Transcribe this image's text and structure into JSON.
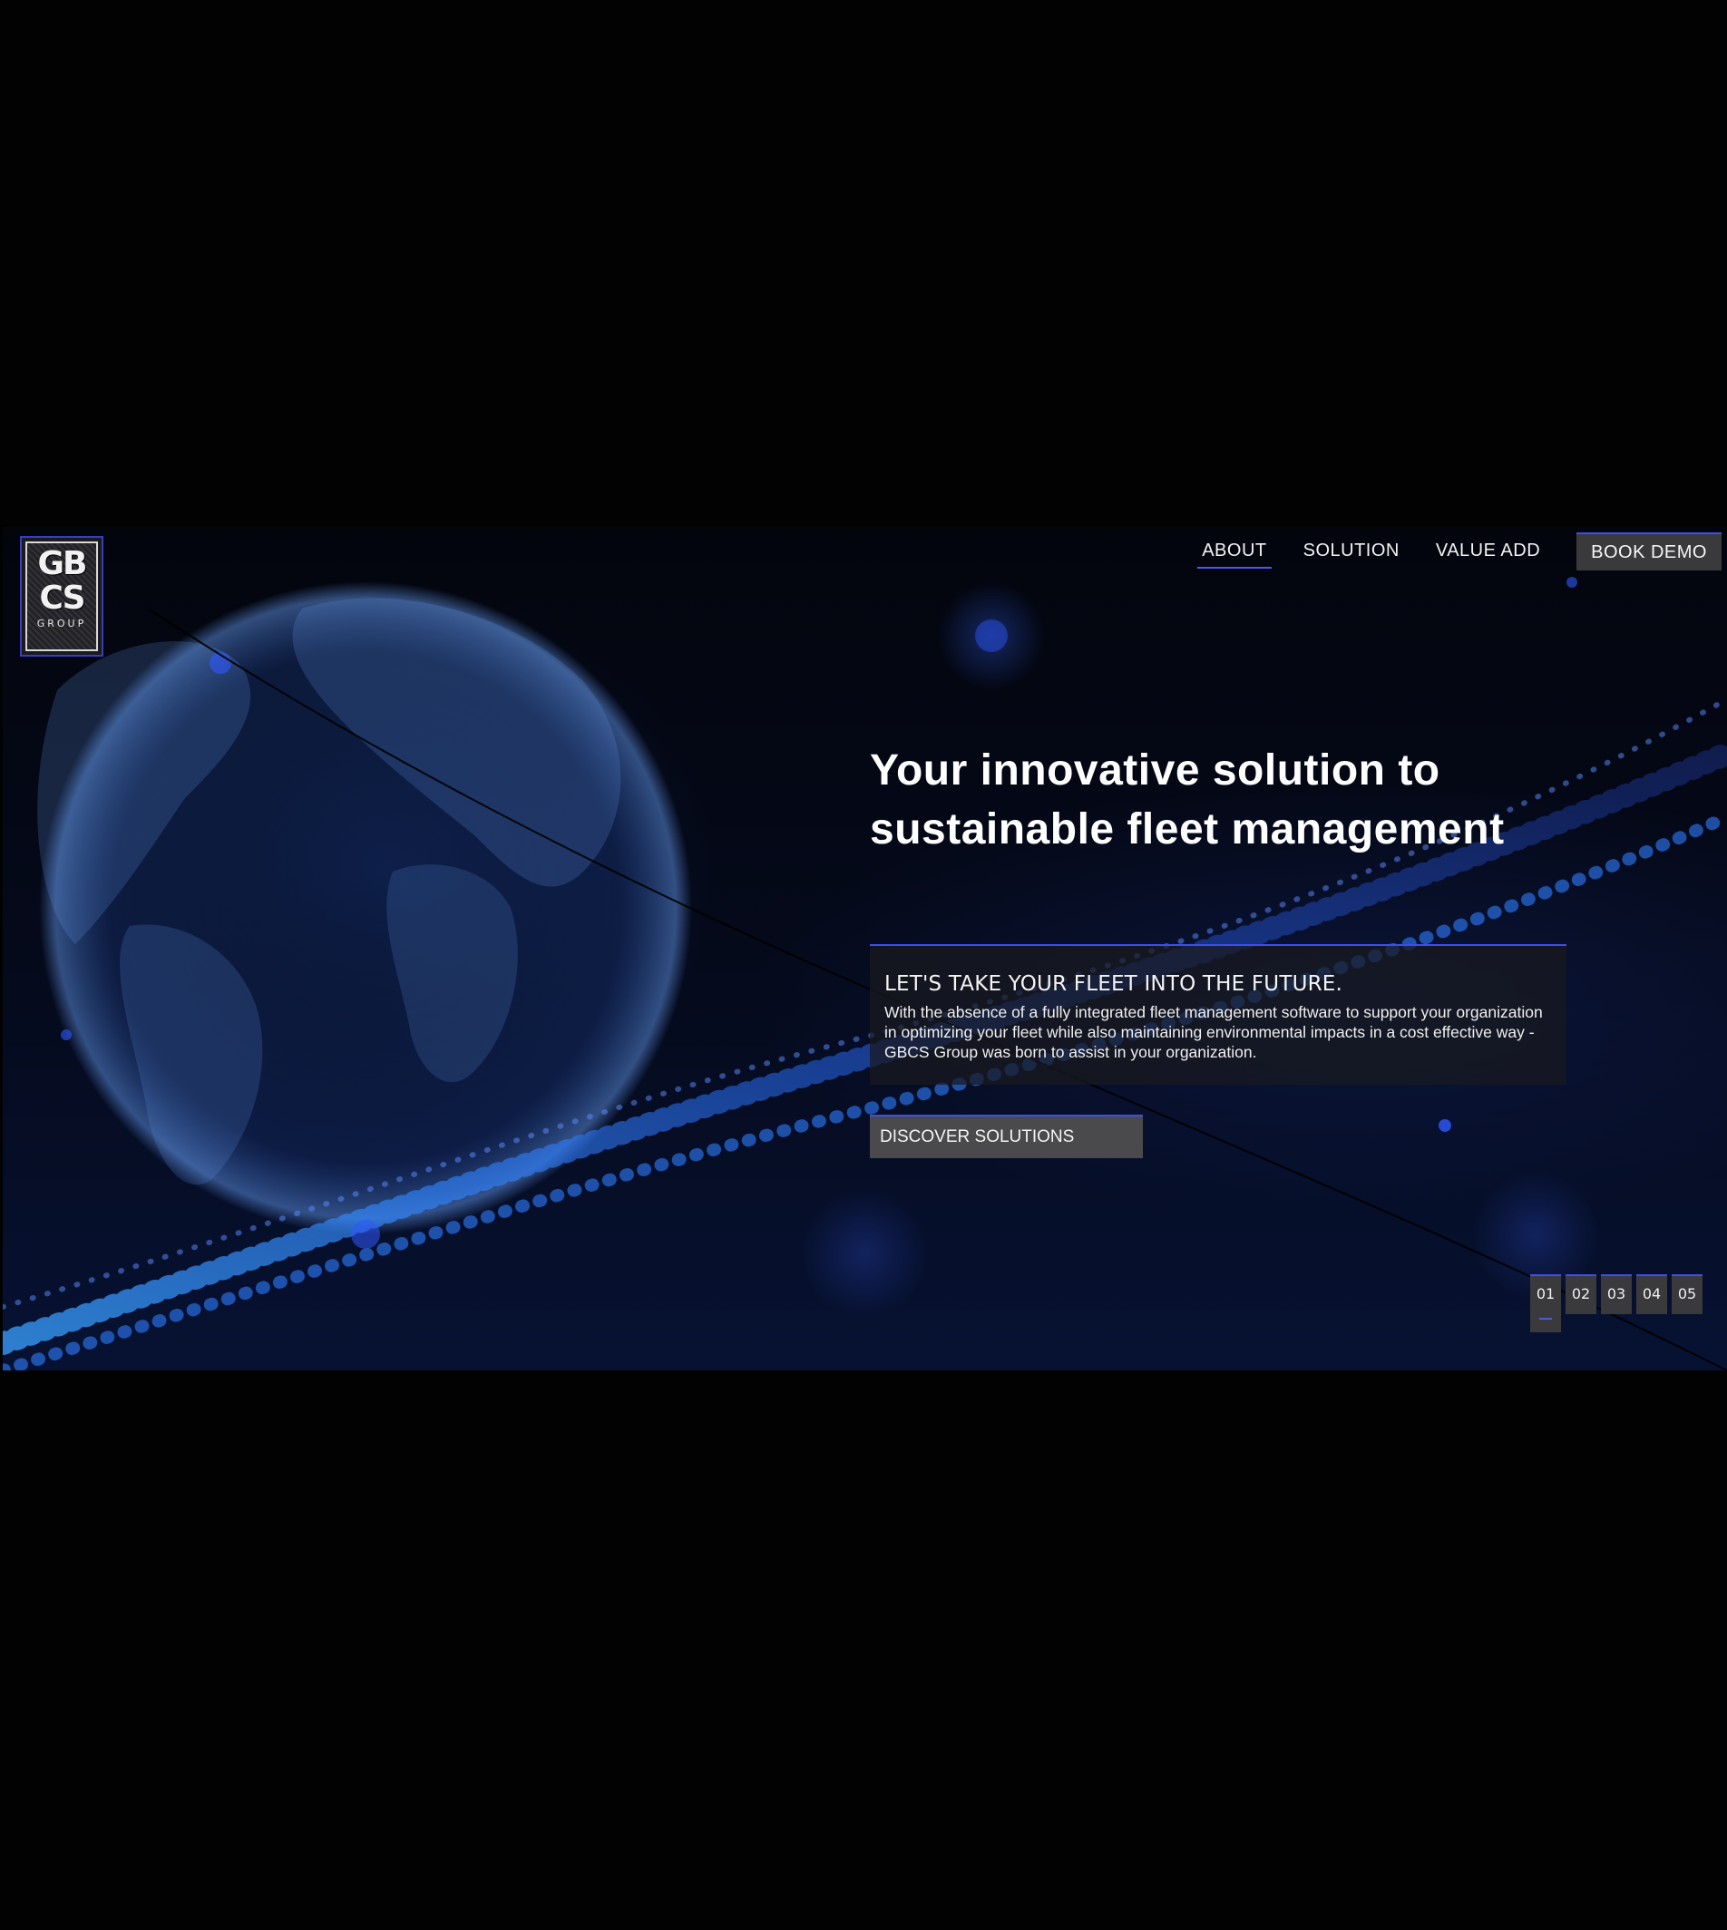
{
  "logo": {
    "letters": "GB\nCS",
    "subtext": "GROUP"
  },
  "nav": {
    "items": [
      {
        "label": "ABOUT"
      },
      {
        "label": "SOLUTION"
      },
      {
        "label": "VALUE ADD"
      }
    ],
    "cta_label": "BOOK DEMO"
  },
  "hero": {
    "headline": "Your innovative solution to sustainable fleet management",
    "subheading": "LET'S TAKE YOUR FLEET INTO THE FUTURE.",
    "body": "With the absence of a fully integrated fleet management software to support your organization in optimizing your fleet while also maintaining environmental impacts in a cost effective way - GBCS Group was born to assist in your organization.",
    "cta_label": "DISCOVER SOLUTIONS"
  },
  "slider": {
    "pages": [
      "01",
      "02",
      "03",
      "04",
      "05"
    ],
    "active_index": 0
  },
  "colors": {
    "page_background": "#020203",
    "accent_blue": "#3d4fe8",
    "panel_gray": "#3a3a3c"
  }
}
